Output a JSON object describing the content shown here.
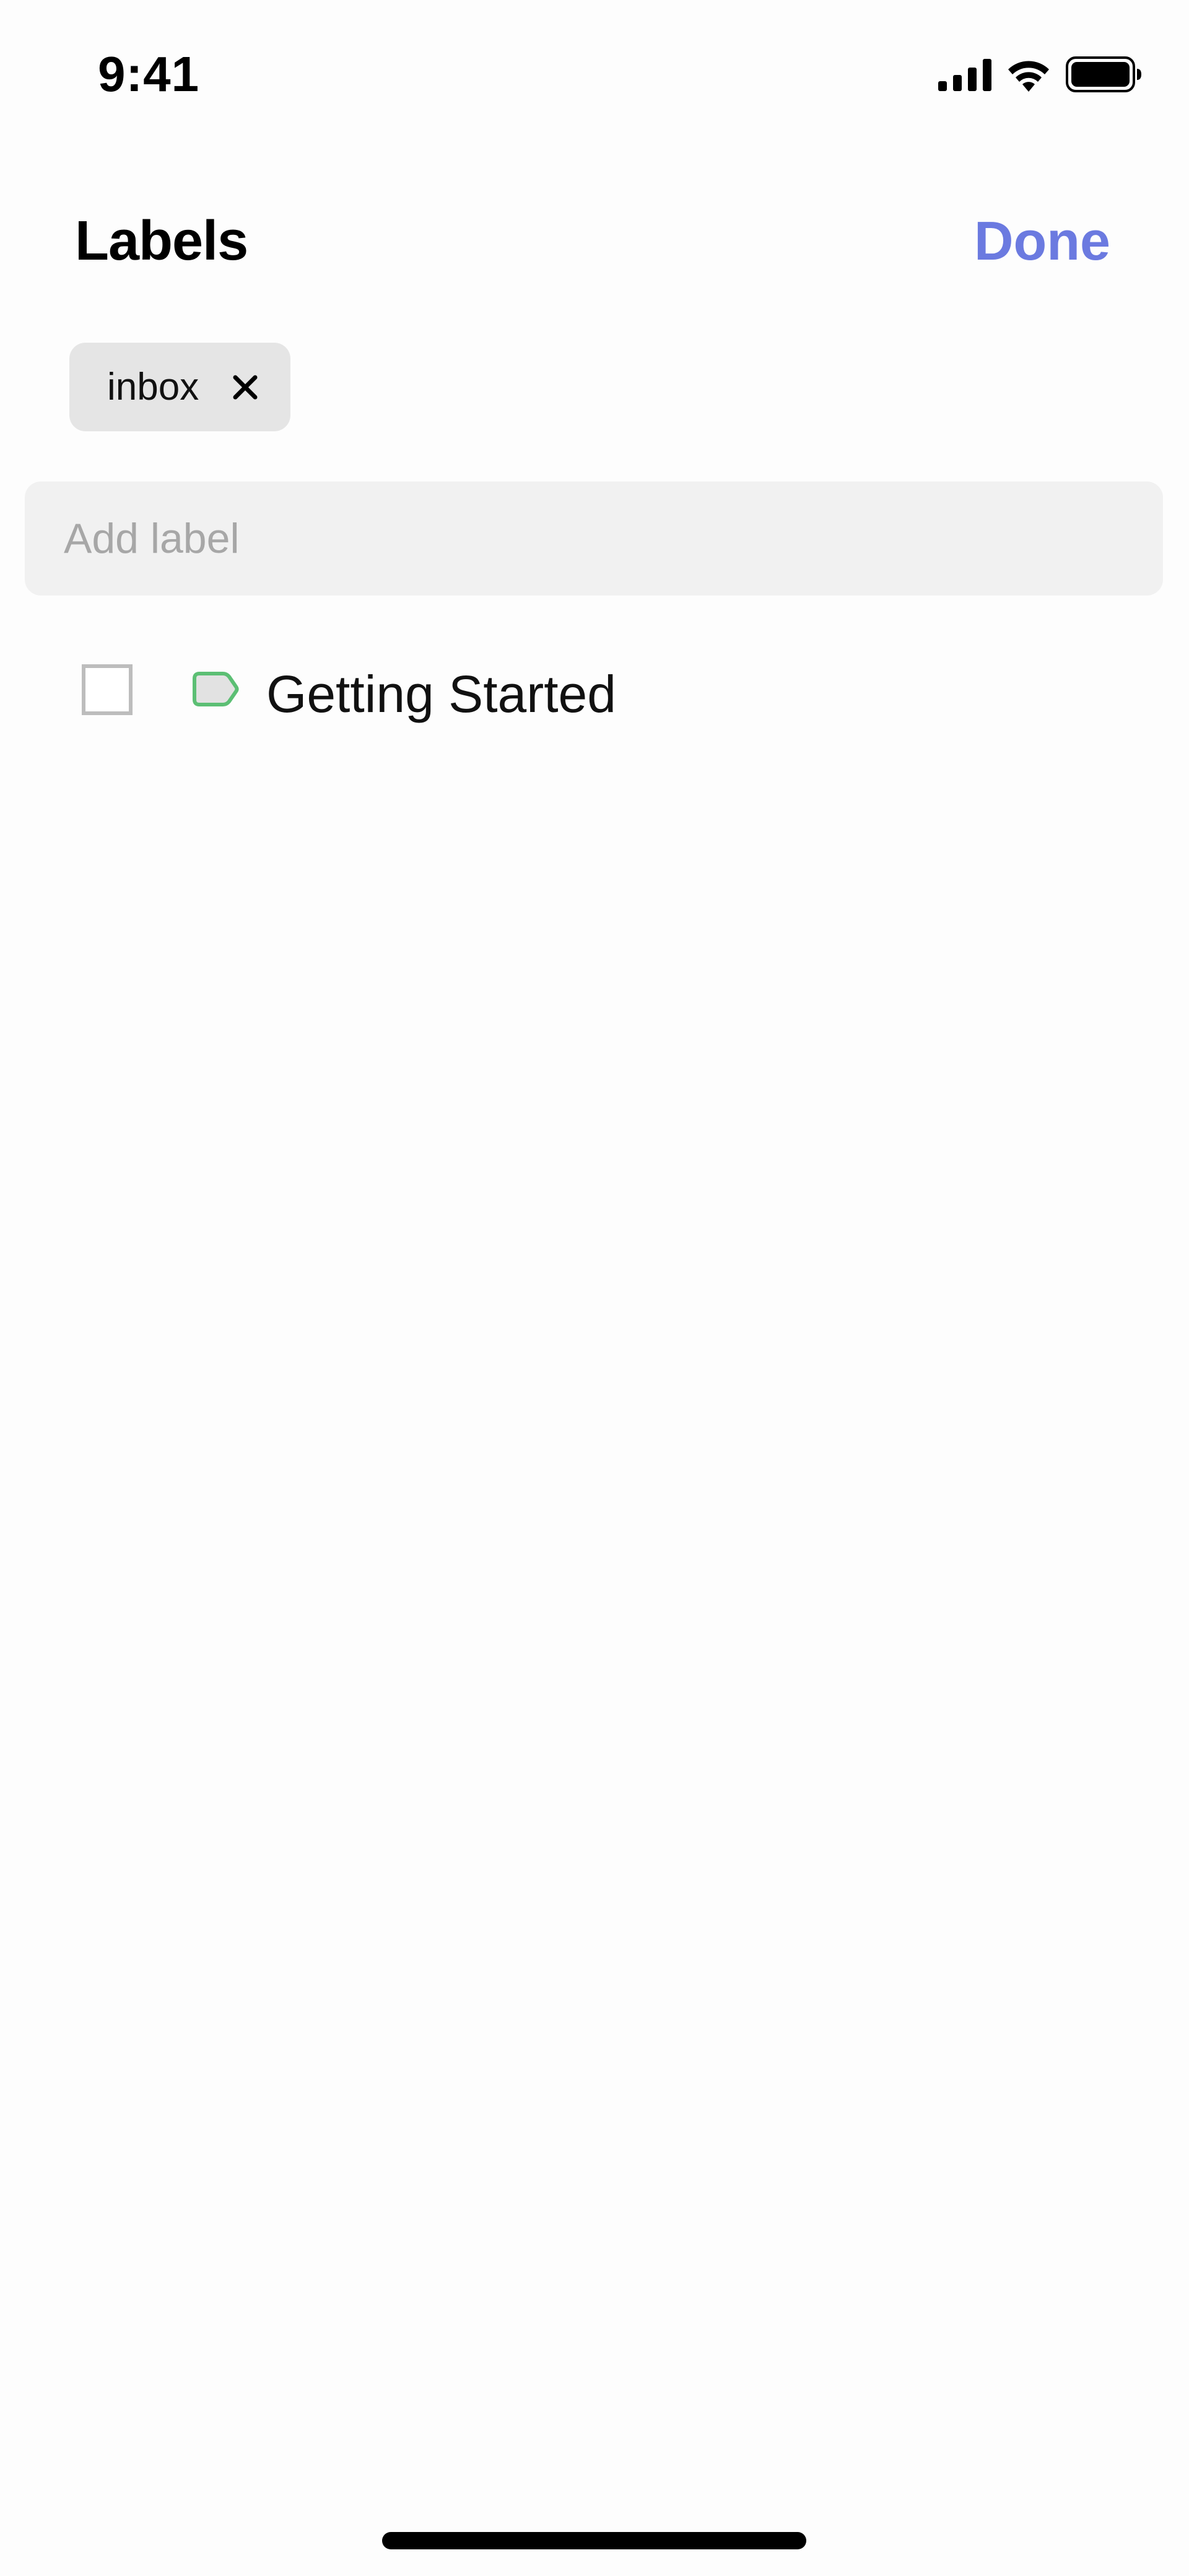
{
  "status_bar": {
    "time": "9:41",
    "icons": [
      "cellular-signal-icon",
      "wifi-icon",
      "battery-icon"
    ]
  },
  "header": {
    "title": "Labels",
    "done_label": "Done"
  },
  "selected_labels": [
    {
      "label": "inbox",
      "remove_icon": "close-icon"
    }
  ],
  "add_label": {
    "placeholder": "Add label",
    "value": ""
  },
  "labels": [
    {
      "label": "Getting Started",
      "checked": false,
      "icon": "tag-icon",
      "color": "#5cbf74"
    }
  ],
  "colors": {
    "accent": "#6b7ae0",
    "chip_background": "#e5e5e5",
    "input_background": "#f1f1f1",
    "tag_green": "#5cbf74"
  }
}
